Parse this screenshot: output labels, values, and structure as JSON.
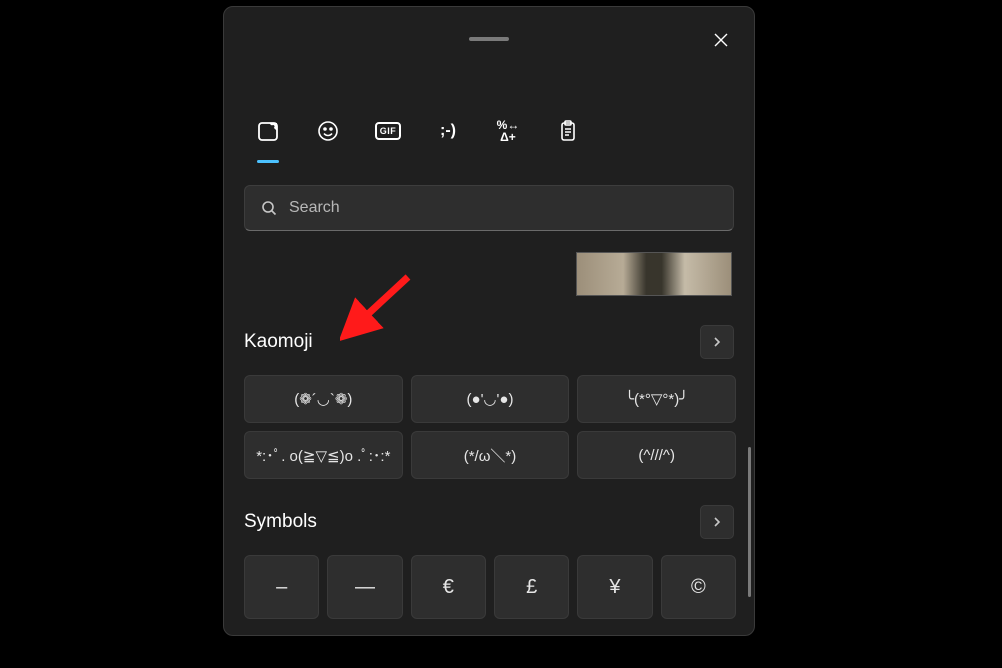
{
  "search": {
    "placeholder": "Search"
  },
  "tabs": {
    "gif_label": "GIF",
    "kao_label": ";-)"
  },
  "sections": {
    "kaomoji": {
      "title": "Kaomoji",
      "items": [
        "(❁´◡`❁)",
        "(●'◡'●)",
        "╰(*°▽°*)╯",
        "*:･ﾟ. o(≧▽≦)o .ﾟ:･:*",
        "(*/ω＼*)",
        "(^///^)"
      ]
    },
    "symbols": {
      "title": "Symbols",
      "items": [
        "–",
        "—",
        "€",
        "£",
        "¥",
        "©"
      ]
    }
  }
}
